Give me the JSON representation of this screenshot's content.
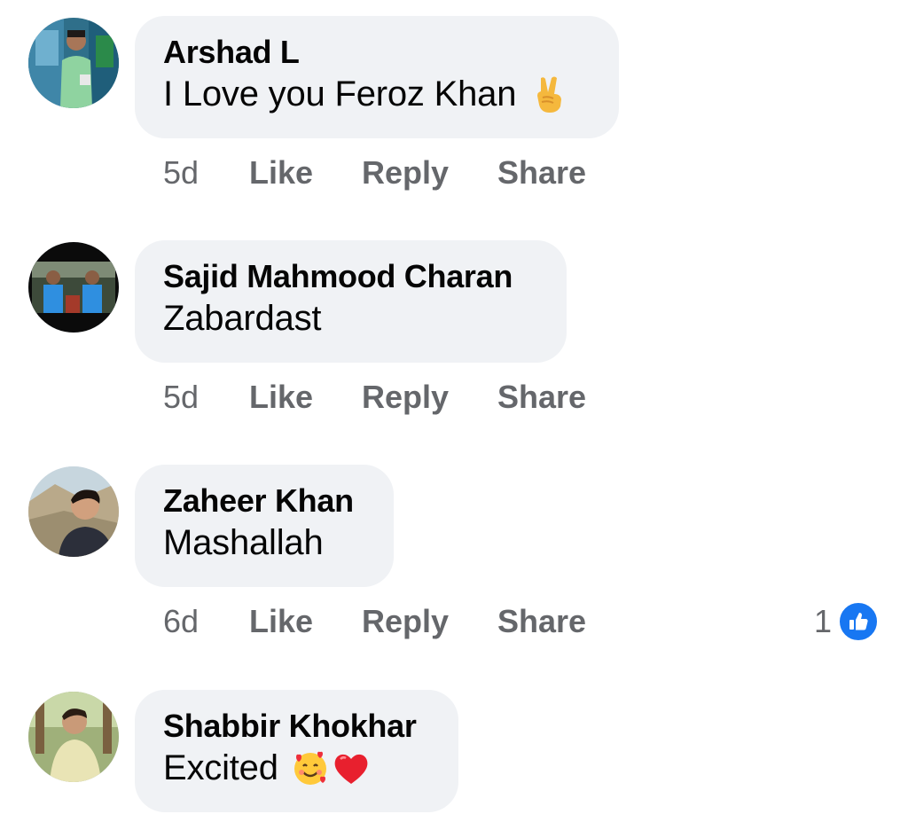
{
  "comments": [
    {
      "author": "Arshad L",
      "text": "I Love you Feroz Khan",
      "emojis": [
        "victory-hand-emoji"
      ],
      "time": "5d",
      "like_label": "Like",
      "reply_label": "Reply",
      "share_label": "Share"
    },
    {
      "author": "Sajid Mahmood Charan",
      "text": "Zabardast",
      "emojis": [],
      "time": "5d",
      "like_label": "Like",
      "reply_label": "Reply",
      "share_label": "Share"
    },
    {
      "author": "Zaheer Khan",
      "text": "Mashallah",
      "emojis": [],
      "time": "6d",
      "like_label": "Like",
      "reply_label": "Reply",
      "share_label": "Share",
      "reaction_count": "1",
      "reaction_icon": "like-reaction-icon"
    },
    {
      "author": "Shabbir Khokhar",
      "text": "Excited",
      "emojis": [
        "smiling-face-with-hearts-emoji",
        "red-heart-emoji"
      ]
    }
  ],
  "colors": {
    "bubble_bg": "#f0f2f5",
    "secondary_text": "#65676b",
    "like_blue": "#1877f2"
  }
}
